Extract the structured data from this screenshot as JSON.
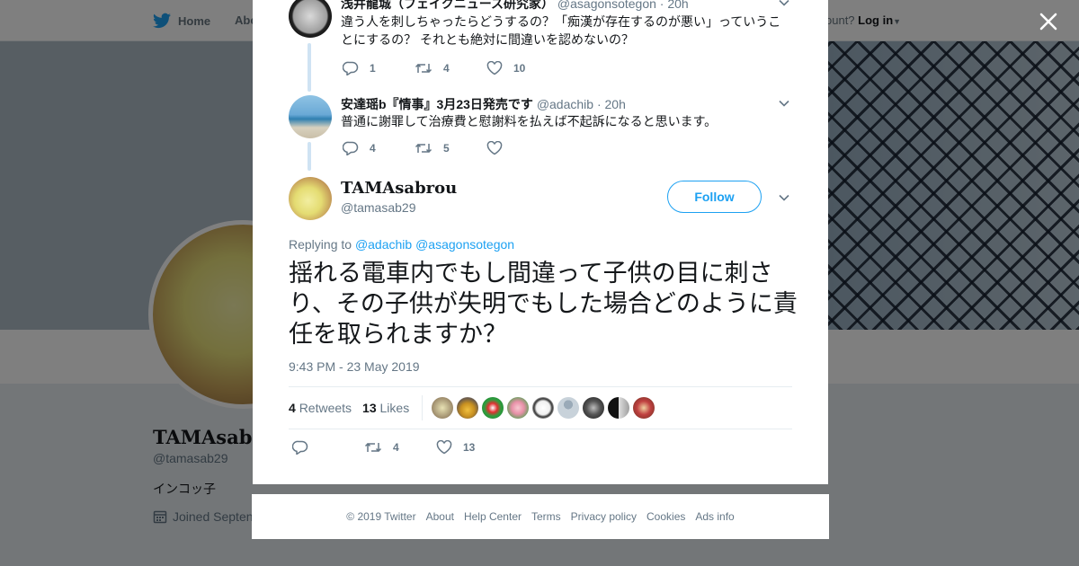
{
  "background_page": {
    "nav": {
      "home": "Home",
      "about": "Abo",
      "account_prompt": "ccount?",
      "login": "Log in"
    },
    "profile": {
      "name": "TAMAsabr",
      "handle": "@tamasab29",
      "bio": "インコッ子",
      "joined": "Joined Septen"
    }
  },
  "modal": {
    "replies": [
      {
        "name": "浅井龍城（フェイクニュース研究家）",
        "handle": "@asagonsotegon",
        "time": "· 20h",
        "text": "違う人を刺しちゃったらどうするの？「痴漢が存在するのが悪い」っていうことにするの？ それとも絶対に間違いを認めないの？",
        "replies": "1",
        "retweets": "4",
        "likes": "10"
      },
      {
        "name": "安達瑶b『情事』3月23日発売です",
        "handle": "@adachib",
        "time": "· 20h",
        "text": "普通に謝罪して治療費と慰謝料を払えば不起訴になると思います。",
        "replies": "4",
        "retweets": "5",
        "likes": ""
      }
    ],
    "main_tweet": {
      "name": "TAMAsabrou",
      "handle": "@tamasab29",
      "follow_label": "Follow",
      "replying_to_label": "Replying to",
      "replying_to_1": "@adachib",
      "replying_to_2": "@asagonsotegon",
      "text": "揺れる電車内でもし間違って子供の目に刺さり、その子供が失明でもした場合どのように責任を取られますか？",
      "timestamp": "9:43 PM - 23 May 2019",
      "retweet_count": "4",
      "retweet_label": "Retweets",
      "like_count": "13",
      "like_label": "Likes",
      "retweets": "4",
      "likes": "13"
    }
  },
  "footer": {
    "links": [
      "© 2019 Twitter",
      "About",
      "Help Center",
      "Terms",
      "Privacy policy",
      "Cookies",
      "Ads info"
    ]
  },
  "colors": {
    "accent": "#1da1f2",
    "muted": "#657786",
    "thread_line": "#cfe3f3"
  },
  "icons": [
    "twitter-bird-icon",
    "close-icon",
    "chevron-down-icon",
    "reply-icon",
    "retweet-icon",
    "heart-icon",
    "calendar-icon"
  ]
}
